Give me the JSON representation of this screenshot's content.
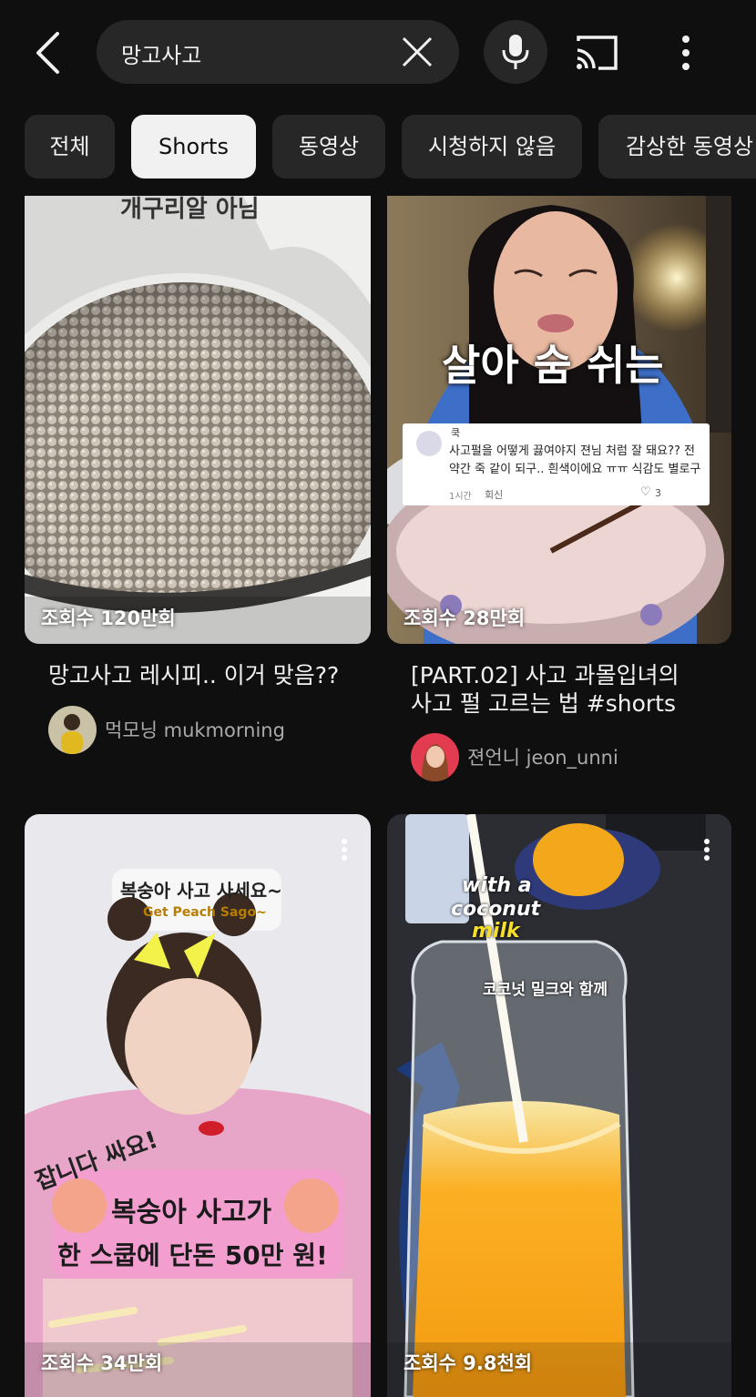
{
  "search": {
    "query": "망고사고"
  },
  "icons": {
    "back": "chevron-left-icon",
    "clear": "close-icon",
    "mic": "microphone-icon",
    "cast": "cast-icon",
    "more": "more-vertical-icon"
  },
  "filters": [
    "전체",
    "Shorts",
    "동영상",
    "시청하지 않음",
    "감상한 동영상"
  ],
  "active_filter": "Shorts",
  "results": [
    {
      "views": "조회수 120만회",
      "title_lines": [
        "망고사고 레시피.. 이거 맞음??"
      ],
      "channel": "먹모닝 mukmorning",
      "thumb_text": "개구리알 아님"
    },
    {
      "views": "조회수 28만회",
      "title_lines": [
        "[PART.02] 사고 과몰입녀의",
        "사고 펄 고르는 법 #shorts"
      ],
      "channel": "젼언니 jeon_unni",
      "thumb_text": "살아 숨 쉬는",
      "comment": {
        "author": "쿡",
        "text": "사고펄을 어떻게 끓여야지 젼님 처럼 잘 돼요?? 전 약간 죽 같이 되구.. 흰색이에요 ㅠㅠ 식감도 별로구",
        "time": "1시간",
        "reply": "회신",
        "likes": "3"
      }
    },
    {
      "views": "조회수 34만회",
      "thumb_text": "복숭아 사고 사세요~",
      "thumb_subtext": "Get Peach Sago~",
      "banner_line1": "복숭아 사고가",
      "banner_line2": "한 스쿱에 단돈 50만 원!",
      "side_text": "잡니다 싸요!"
    },
    {
      "views": "조회수 9.8천회",
      "thumb_line1": "with a",
      "thumb_line2": "coconut",
      "thumb_line3": "milk",
      "thumb_subtext": "코코넛 밀크와 함께"
    }
  ],
  "colors": {
    "background": "#0f0f0f",
    "chip": "#272727",
    "chip_active": "#f1f1f1",
    "text_primary": "#f1f1f1",
    "text_secondary": "#aaaaaa"
  }
}
